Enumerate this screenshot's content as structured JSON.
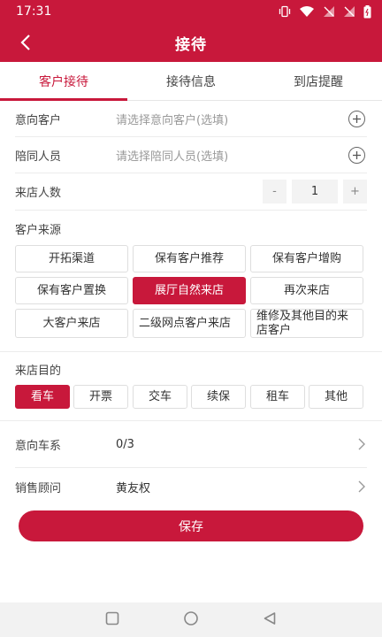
{
  "status_bar": {
    "time": "17:31",
    "icons": [
      "vibrate-icon",
      "wifi-icon",
      "signal-off-icon",
      "signal-off-icon",
      "battery-icon"
    ]
  },
  "app_bar": {
    "title": "接待",
    "back_icon": "back-arrow-icon"
  },
  "tabs": [
    {
      "label": "客户接待",
      "active": true
    },
    {
      "label": "接待信息",
      "active": false
    },
    {
      "label": "到店提醒",
      "active": false
    }
  ],
  "form": {
    "intent_customer": {
      "label": "意向客户",
      "placeholder": "请选择意向客户(选填)"
    },
    "companion": {
      "label": "陪同人员",
      "placeholder": "请选择陪同人员(选填)"
    },
    "visitor_count": {
      "label": "来店人数",
      "minus": "-",
      "value": "1",
      "plus": "+"
    },
    "customer_source": {
      "label": "客户来源",
      "options": [
        "开拓渠道",
        "保有客户推荐",
        "保有客户增购",
        "保有客户置换",
        "展厅自然来店",
        "再次来店",
        "大客户来店",
        "二级网点客户来店",
        "维修及其他目的来店客户"
      ],
      "selected": "展厅自然来店"
    },
    "visit_purpose": {
      "label": "来店目的",
      "options": [
        "看车",
        "开票",
        "交车",
        "续保",
        "租车",
        "其他"
      ],
      "selected": "看车"
    },
    "intent_series": {
      "label": "意向车系",
      "value": "0/3"
    },
    "sales_consultant": {
      "label": "销售顾问",
      "value": "黄友权"
    }
  },
  "save_label": "保存",
  "nav_bar": [
    "square-icon",
    "circle-icon",
    "triangle-back-icon"
  ]
}
